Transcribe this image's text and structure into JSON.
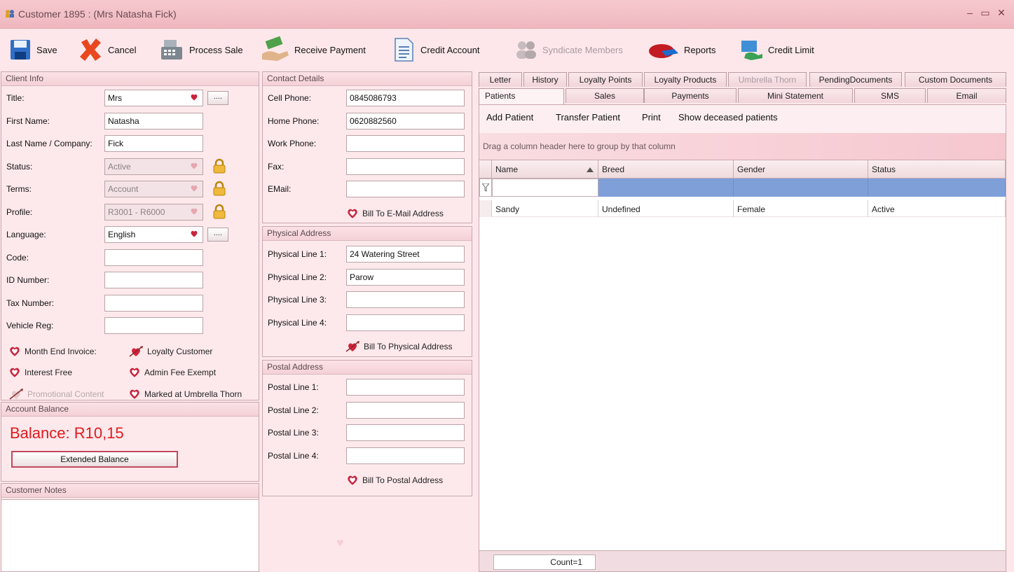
{
  "window": {
    "title": "Customer 1895 : (Mrs Natasha Fick)",
    "controls": [
      "–",
      "▭",
      "✕"
    ]
  },
  "toolbar": [
    {
      "label": "Save",
      "icon": "save-disk-icon"
    },
    {
      "label": "Cancel",
      "icon": "cancel-x-icon"
    },
    {
      "label": "Process Sale",
      "icon": "cash-register-icon"
    },
    {
      "label": "Receive Payment",
      "icon": "payment-hand-icon"
    },
    {
      "label": "Credit Account",
      "icon": "document-icon"
    },
    {
      "label": "Syndicate Members",
      "icon": "users-icon",
      "disabled": true
    },
    {
      "label": "Reports",
      "icon": "pie-chart-icon"
    },
    {
      "label": "Credit Limit",
      "icon": "monitor-hand-icon"
    }
  ],
  "client_info": {
    "header": "Client Info",
    "fields": [
      {
        "label": "Title:",
        "value": "Mrs",
        "type": "dropdown",
        "extra": "dots"
      },
      {
        "label": "First Name:",
        "value": "Natasha",
        "type": "text"
      },
      {
        "label": "Last Name / Company:",
        "value": "Fick",
        "type": "text"
      },
      {
        "label": "Status:",
        "value": "Active",
        "type": "dropdown-disabled",
        "extra": "lock"
      },
      {
        "label": "Terms:",
        "value": "Account",
        "type": "dropdown-disabled",
        "extra": "lock"
      },
      {
        "label": "Profile:",
        "value": "R3001 - R6000",
        "type": "dropdown-disabled",
        "extra": "lock"
      },
      {
        "label": "Language:",
        "value": "English",
        "type": "dropdown",
        "extra": "dots"
      },
      {
        "label": "Code:",
        "value": "",
        "type": "text"
      },
      {
        "label": "ID Number:",
        "value": "",
        "type": "text"
      },
      {
        "label": "Tax Number:",
        "value": "",
        "type": "text"
      },
      {
        "label": "Vehicle Reg:",
        "value": "",
        "type": "text"
      }
    ],
    "dots_label": "....",
    "checks": [
      {
        "label": "Month End Invoice:",
        "checked": false
      },
      {
        "label": "Loyalty Customer",
        "checked": true
      },
      {
        "label": "Interest Free",
        "checked": false
      },
      {
        "label": "Admin Fee Exempt",
        "checked": false
      },
      {
        "label": "Promotional Content",
        "checked": true,
        "disabled": true
      },
      {
        "label": "Marked at Umbrella Thorn",
        "checked": false
      }
    ]
  },
  "account_balance": {
    "header": "Account Balance",
    "balance": "Balance: R10,15",
    "button": "Extended Balance"
  },
  "customer_notes": {
    "header": "Customer Notes",
    "value": ""
  },
  "contact_details": {
    "header": "Contact Details",
    "fields": [
      {
        "label": "Cell Phone:",
        "value": "0845086793"
      },
      {
        "label": "Home Phone:",
        "value": "0620882560"
      },
      {
        "label": "Work Phone:",
        "value": ""
      },
      {
        "label": "Fax:",
        "value": ""
      },
      {
        "label": "EMail:",
        "value": ""
      }
    ],
    "bill_to": "Bill To E-Mail Address"
  },
  "physical_address": {
    "header": "Physical Address",
    "fields": [
      {
        "label": "Physical Line 1:",
        "value": "24 Watering Street"
      },
      {
        "label": "Physical Line 2:",
        "value": "Parow"
      },
      {
        "label": "Physical Line 3:",
        "value": ""
      },
      {
        "label": "Physical Line 4:",
        "value": ""
      }
    ],
    "bill_to": "Bill To Physical Address"
  },
  "postal_address": {
    "header": "Postal Address",
    "fields": [
      {
        "label": "Postal Line 1:",
        "value": ""
      },
      {
        "label": "Postal Line 2:",
        "value": ""
      },
      {
        "label": "Postal Line 3:",
        "value": ""
      },
      {
        "label": "Postal Line 4:",
        "value": ""
      }
    ],
    "bill_to": "Bill To Postal Address"
  },
  "tabs": {
    "row1": [
      "Letter",
      "History",
      "Loyalty Points",
      "Loyalty Products",
      "Umbrella Thorn",
      "PendingDocuments",
      "Custom Documents"
    ],
    "row2": [
      "Patients",
      "Sales",
      "Payments",
      "Mini Statement",
      "SMS",
      "Email"
    ],
    "active": "Patients",
    "disabled": [
      "Umbrella Thorn"
    ]
  },
  "patients": {
    "actions": [
      "Add Patient",
      "Transfer Patient",
      "Print",
      "Show deceased patients"
    ],
    "group_hint": "Drag a column header here to group by that column",
    "columns": [
      "Name",
      "Breed",
      "Gender",
      "Status"
    ],
    "sorted_column": "Name",
    "rows": [
      {
        "name": "Sandy",
        "breed": "Undefined",
        "gender": "Female",
        "status": "Active"
      }
    ],
    "count": "Count=1"
  },
  "colors": {
    "accent": "#e0191d",
    "heart": "#d2223b",
    "filter_row": "#7f9fd9",
    "background": "#fde7ea"
  }
}
